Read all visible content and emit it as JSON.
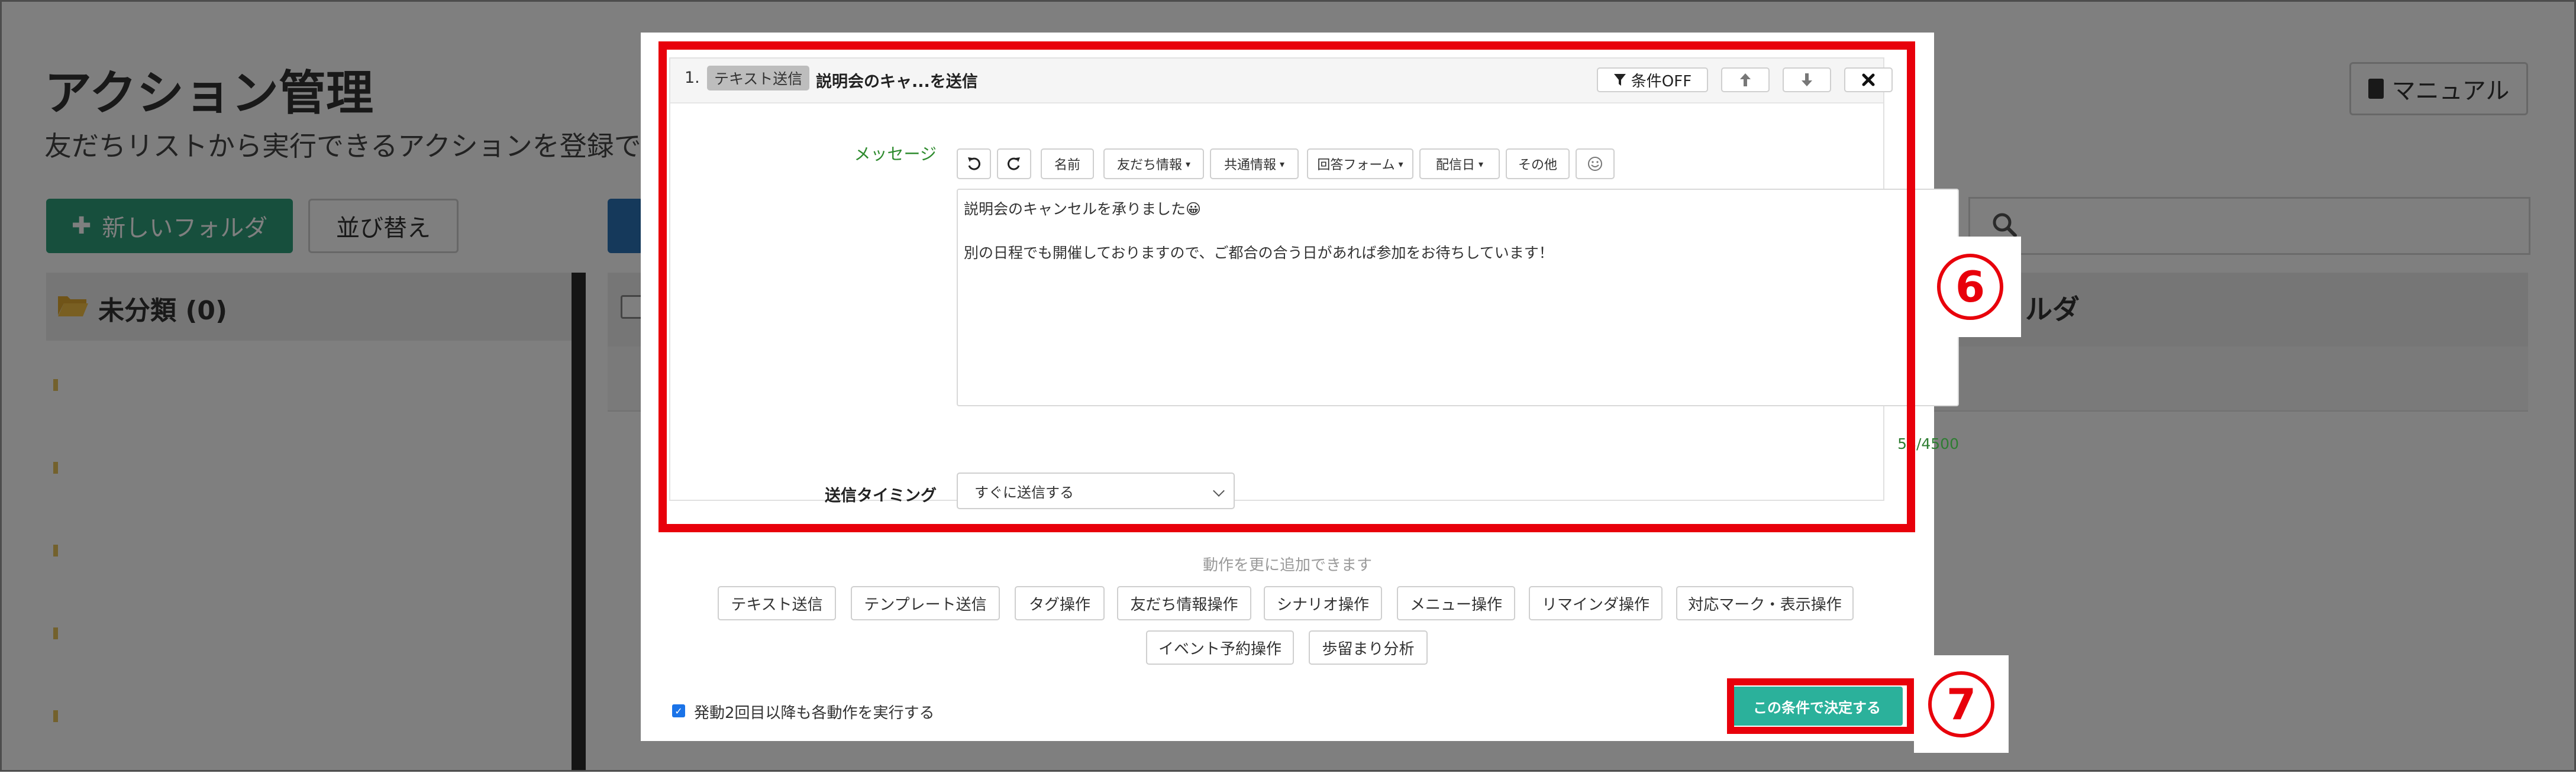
{
  "background": {
    "title": "アクション管理",
    "subtitle": "友だちリストから実行できるアクションを登録でき",
    "new_folder_label": "新しいフォルダ",
    "reorder_label": "並び替え",
    "manual_label": "マニュアル",
    "unsorted_folder_label": "未分類 (0)",
    "folder_header_tail": "ルダ"
  },
  "action": {
    "index": "1.",
    "type_badge": "テキスト送信",
    "title": "説明会のキャ...を送信",
    "condition_off_label": "条件OFF"
  },
  "message": {
    "label": "メッセージ",
    "toolbar": {
      "name": "名前",
      "friend_info": "友だち情報",
      "common_info": "共通情報",
      "answer_form": "回答フォーム",
      "delivery_date": "配信日",
      "other": "その他"
    },
    "text": "説明会のキャンセルを承りました😀\n\n別の日程でも開催しておりますので、ご都合の合う日があれば参加をお待ちしています！",
    "char_count": "58/4500"
  },
  "timing": {
    "label": "送信タイミング",
    "selected": "すぐに送信する"
  },
  "add_actions": {
    "hint": "動作を更に追加できます",
    "buttons": [
      "テキスト送信",
      "テンプレート送信",
      "タグ操作",
      "友だち情報操作",
      "シナリオ操作",
      "メニュー操作",
      "リマインダ操作",
      "対応マーク・表示操作",
      "イベント予約操作",
      "歩留まり分析"
    ]
  },
  "footer": {
    "repeat_label": "発動2回目以降も各動作を実行する",
    "repeat_checked": true,
    "confirm_label": "この条件で決定する"
  },
  "annotations": {
    "step6": "⑥",
    "step7": "⑦"
  },
  "colors": {
    "accent_green": "#2bb19b",
    "annotation_red": "#e8000b",
    "folder_green": "#2e9e7a"
  }
}
